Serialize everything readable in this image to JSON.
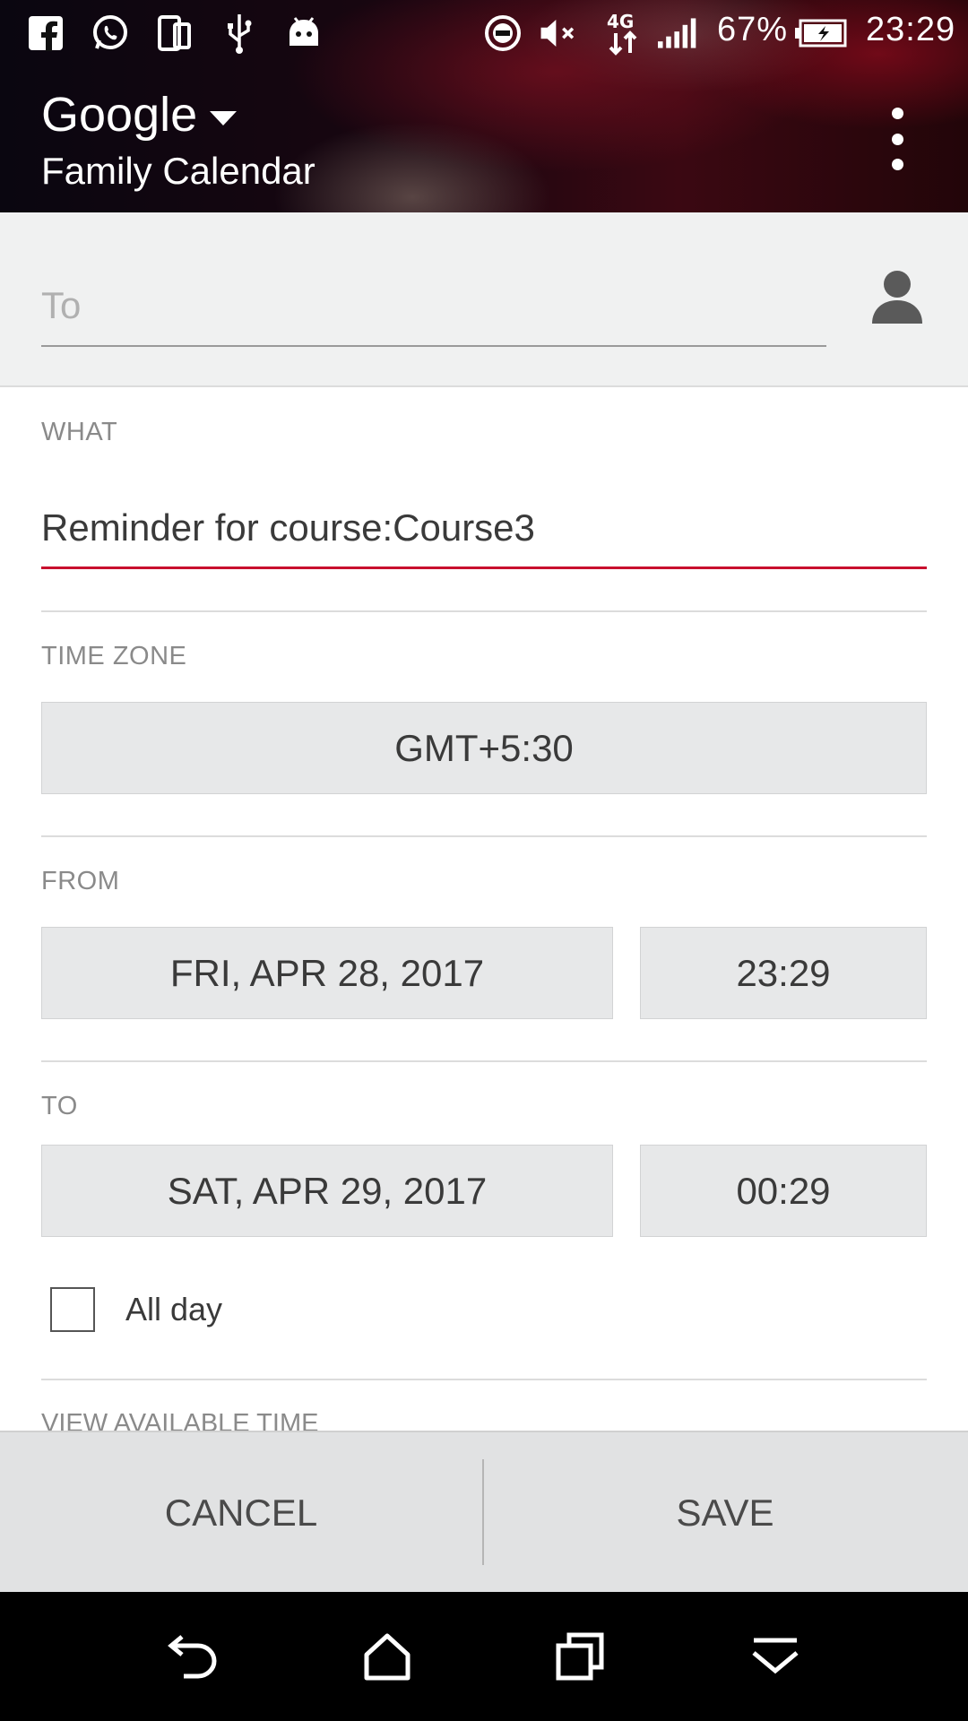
{
  "status_bar": {
    "battery": "67%",
    "time": "23:29",
    "network": "4G",
    "icons": [
      "facebook-icon",
      "whatsapp-icon",
      "screen-mirror-icon",
      "usb-icon",
      "android-debug-icon",
      "do-not-disturb-icon",
      "mute-icon",
      "network-4g-icon",
      "signal-icon",
      "battery-charging-icon"
    ]
  },
  "app_bar": {
    "account": "Google",
    "calendar": "Family Calendar"
  },
  "to_field": {
    "placeholder": "To"
  },
  "what": {
    "label": "WHAT",
    "value": "Reminder for course:Course3"
  },
  "time_zone": {
    "label": "TIME ZONE",
    "value": "GMT+5:30"
  },
  "from": {
    "label": "FROM",
    "date": "FRI, APR 28, 2017",
    "time": "23:29"
  },
  "to": {
    "label": "TO",
    "date": "SAT, APR 29, 2017",
    "time": "00:29"
  },
  "all_day": {
    "label": "All day",
    "checked": false
  },
  "view_available": {
    "label": "VIEW AVAILABLE TIME"
  },
  "actions": {
    "cancel": "CANCEL",
    "save": "SAVE"
  },
  "colors": {
    "accent": "#c8102e",
    "field_bg": "#e7e8e9",
    "action_bar_bg": "#e1e2e3"
  }
}
